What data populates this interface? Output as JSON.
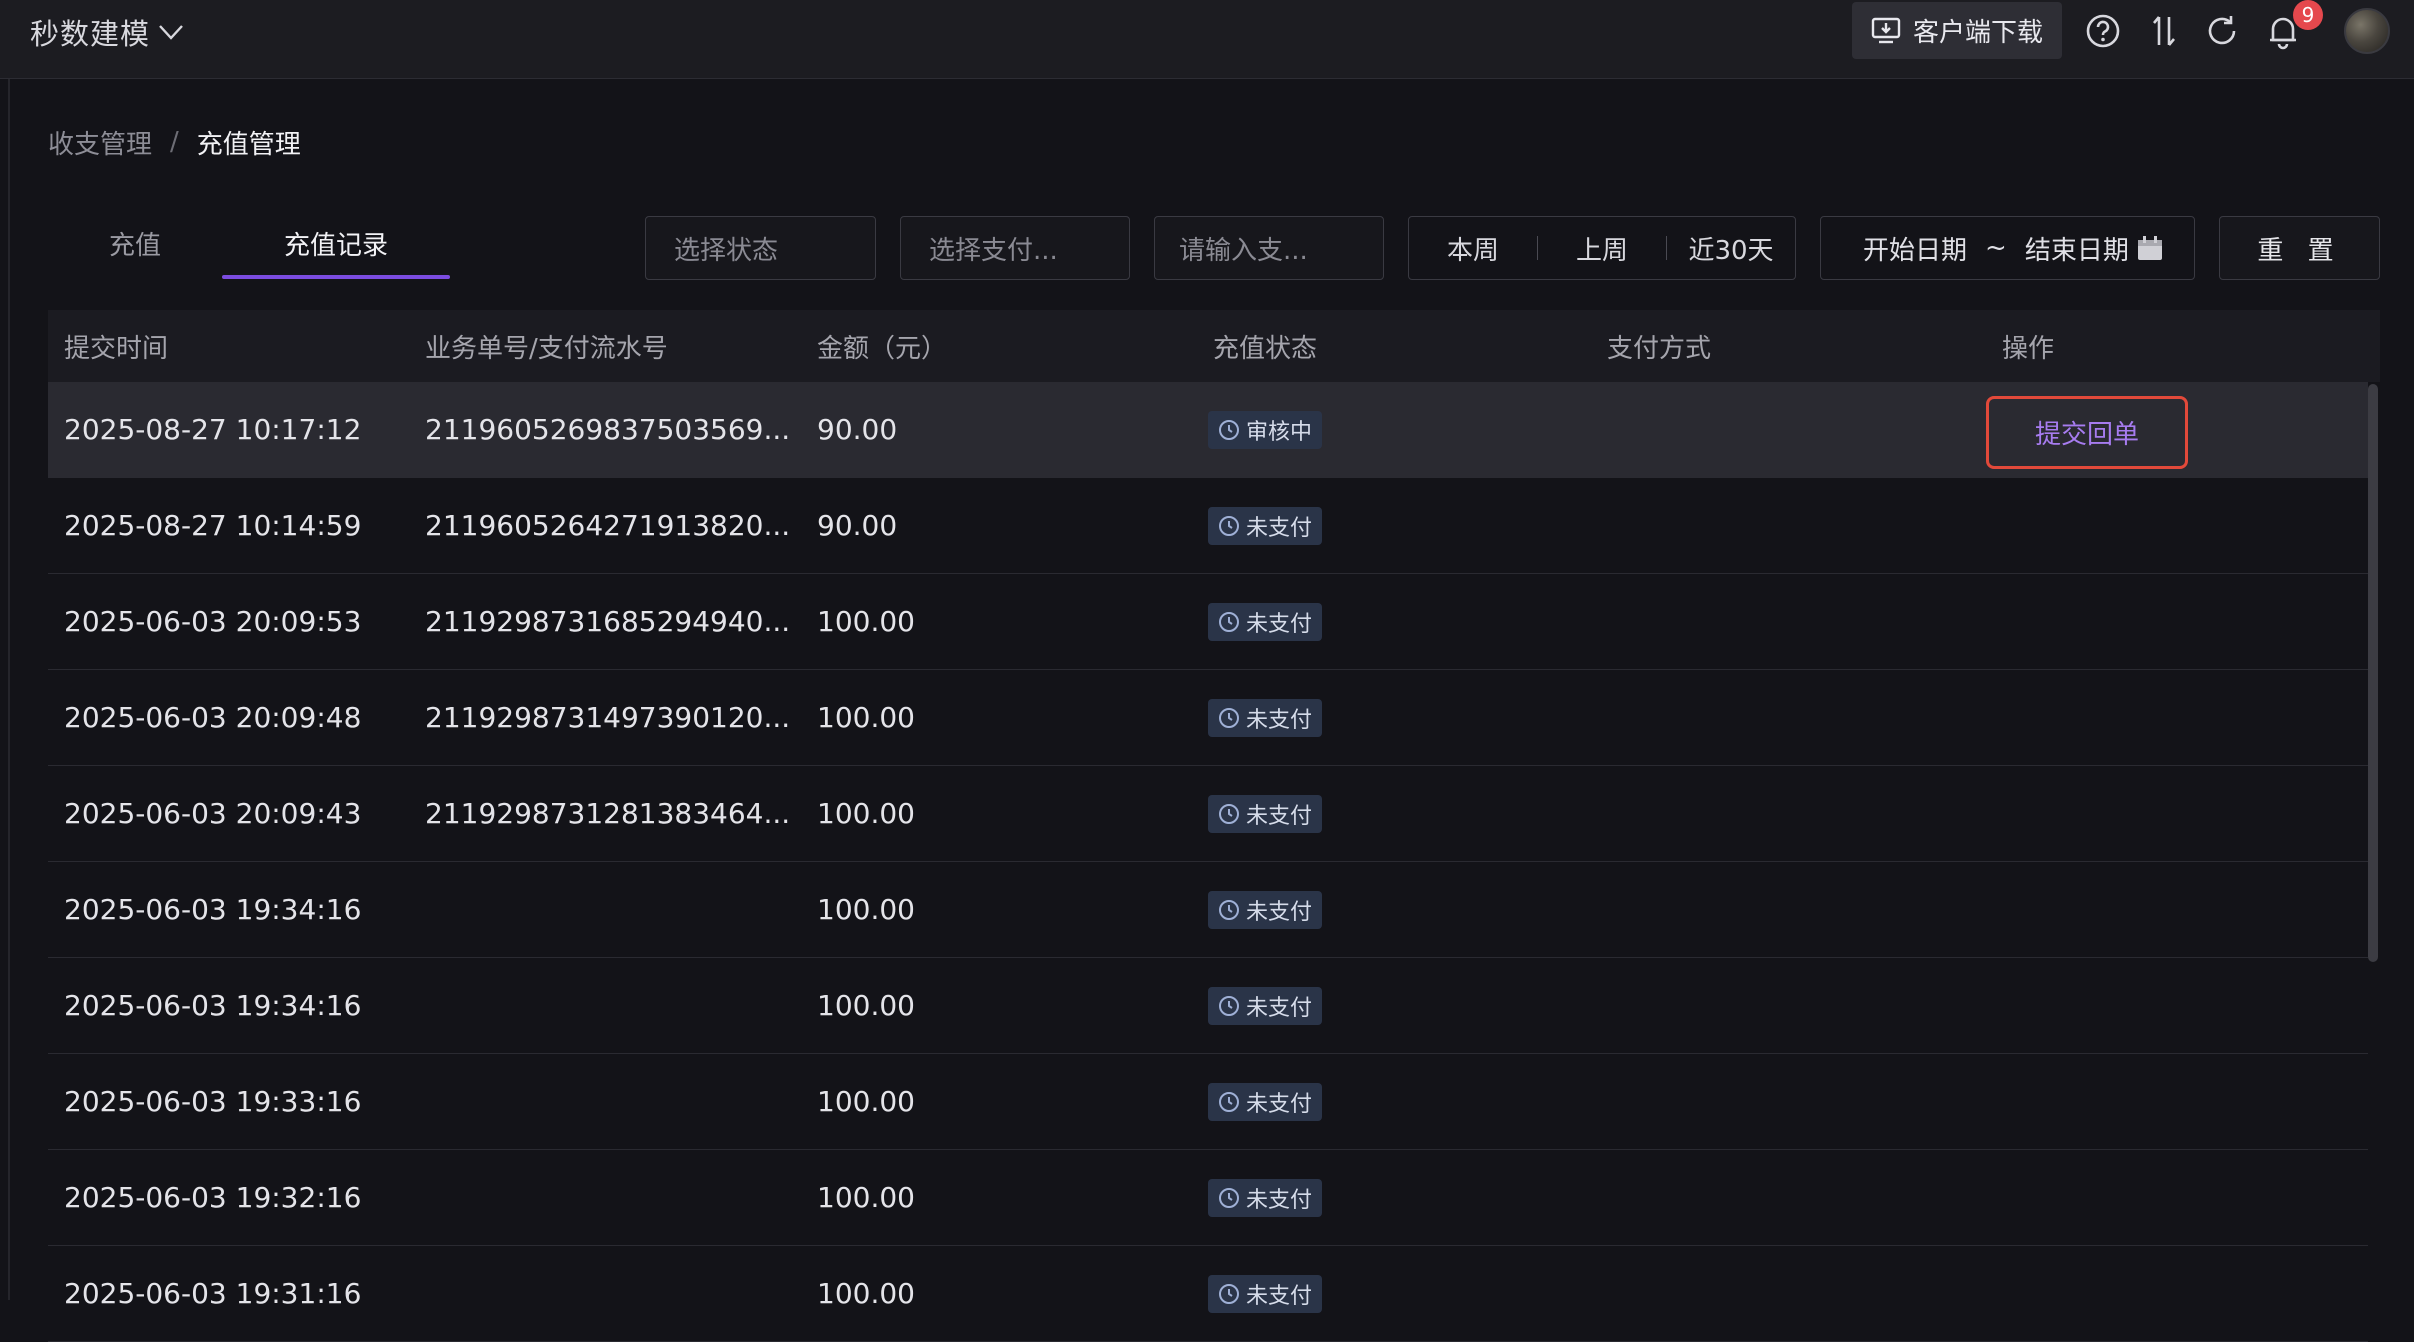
{
  "app": {
    "title": "秒数建模"
  },
  "topbar": {
    "download_label": "客户端下载",
    "notification_count": "9",
    "icons": [
      "download-icon",
      "help-icon",
      "sort-icon",
      "refresh-icon",
      "bell-icon",
      "avatar"
    ]
  },
  "breadcrumb": {
    "parent": "收支管理",
    "separator": "/",
    "current": "充值管理"
  },
  "tabs": [
    {
      "label": "充值",
      "active": false
    },
    {
      "label": "充值记录",
      "active": true
    }
  ],
  "filters": {
    "status_placeholder": "选择状态",
    "payment_placeholder": "选择支付...",
    "search_placeholder": "请输入支...",
    "quick_ranges": [
      "本周",
      "上周",
      "近30天"
    ],
    "date_start": "开始日期",
    "date_sep": "~",
    "date_end": "结束日期",
    "reset_label": "重 置"
  },
  "table": {
    "columns": [
      "提交时间",
      "业务单号/支付流水号",
      "金额（元）",
      "充值状态",
      "支付方式",
      "操作"
    ],
    "rows": [
      {
        "time": "2025-08-27 10:17:12",
        "order": "2119605269837503569...",
        "amount": "90.00",
        "status": "审核中",
        "payment": "",
        "action": "提交回单"
      },
      {
        "time": "2025-08-27 10:14:59",
        "order": "2119605264271913820...",
        "amount": "90.00",
        "status": "未支付",
        "payment": "",
        "action": ""
      },
      {
        "time": "2025-06-03 20:09:53",
        "order": "2119298731685294940...",
        "amount": "100.00",
        "status": "未支付",
        "payment": "",
        "action": ""
      },
      {
        "time": "2025-06-03 20:09:48",
        "order": "2119298731497390120...",
        "amount": "100.00",
        "status": "未支付",
        "payment": "",
        "action": ""
      },
      {
        "time": "2025-06-03 20:09:43",
        "order": "2119298731281383464...",
        "amount": "100.00",
        "status": "未支付",
        "payment": "",
        "action": ""
      },
      {
        "time": "2025-06-03 19:34:16",
        "order": "",
        "amount": "100.00",
        "status": "未支付",
        "payment": "",
        "action": ""
      },
      {
        "time": "2025-06-03 19:34:16",
        "order": "",
        "amount": "100.00",
        "status": "未支付",
        "payment": "",
        "action": ""
      },
      {
        "time": "2025-06-03 19:33:16",
        "order": "",
        "amount": "100.00",
        "status": "未支付",
        "payment": "",
        "action": ""
      },
      {
        "time": "2025-06-03 19:32:16",
        "order": "",
        "amount": "100.00",
        "status": "未支付",
        "payment": "",
        "action": ""
      },
      {
        "time": "2025-06-03 19:31:16",
        "order": "",
        "amount": "100.00",
        "status": "未支付",
        "payment": "",
        "action": ""
      }
    ]
  },
  "colors": {
    "accent": "#7b4ce0",
    "link": "#a77cf0",
    "highlight_border": "#e2493a",
    "badge": "#e5484d"
  }
}
